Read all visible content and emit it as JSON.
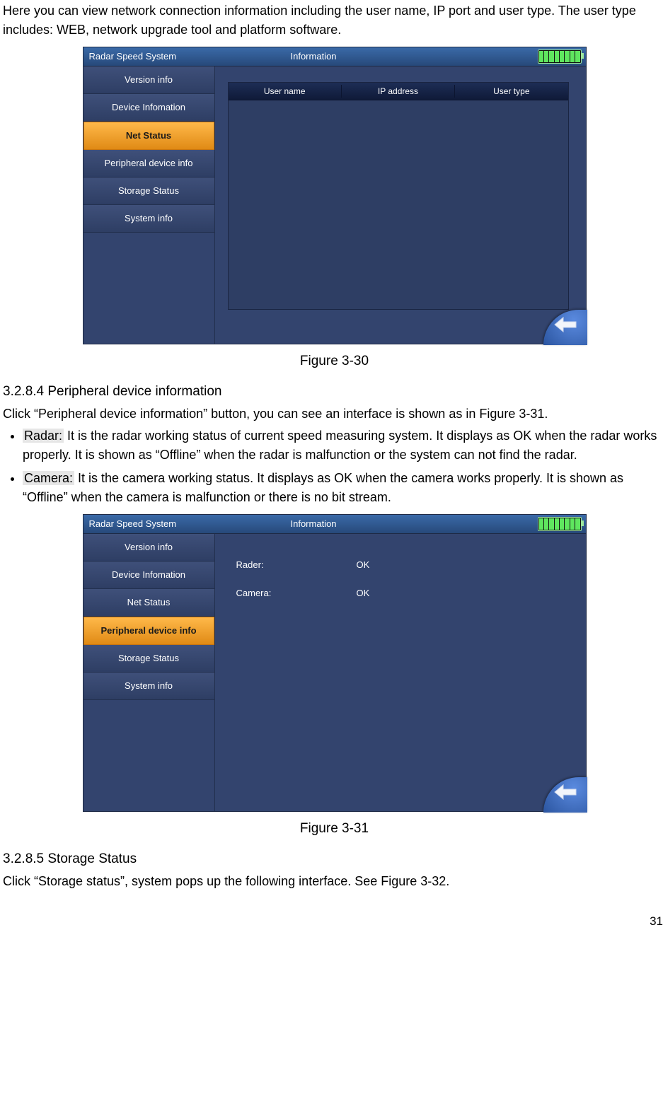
{
  "intro_text": "Here you can view network connection information including the user name, IP port and user type. The user type includes: WEB, network upgrade tool and platform software.",
  "figure30": {
    "caption": "Figure 3-30",
    "titlebar_left": "Radar Speed System",
    "titlebar_center": "Information",
    "sidebar_items": [
      "Version info",
      "Device Infomation",
      "Net Status",
      "Peripheral device info",
      "Storage Status",
      "System info"
    ],
    "active_index": 2,
    "table_headers": [
      "User name",
      "IP address",
      "User type"
    ]
  },
  "section_3_2_8_4": {
    "heading": "3.2.8.4  Peripheral device information",
    "lead": "Click “Peripheral device information” button, you can see an interface is shown as in Figure 3-31.",
    "bullets": [
      {
        "label": "Radar:",
        "text": " It is the radar working status of current speed measuring system. It displays as OK when the radar works properly. It is shown as “Offline” when the radar is malfunction or the system can not find the radar."
      },
      {
        "label": "Camera:",
        "text": " It is the camera working status. It displays as OK when the camera works properly. It is shown as “Offline” when the camera is malfunction or there is no bit stream."
      }
    ]
  },
  "figure31": {
    "caption": "Figure 3-31",
    "titlebar_left": "Radar Speed System",
    "titlebar_center": "Information",
    "sidebar_items": [
      "Version info",
      "Device Infomation",
      "Net Status",
      "Peripheral device info",
      "Storage Status",
      "System info"
    ],
    "active_index": 3,
    "rows": [
      {
        "k": "Rader:",
        "v": "OK"
      },
      {
        "k": "Camera:",
        "v": "OK"
      }
    ]
  },
  "section_3_2_8_5": {
    "heading": "3.2.8.5  Storage Status",
    "lead": "Click “Storage status”, system pops up the following interface. See Figure 3-32."
  },
  "page_number": "31"
}
